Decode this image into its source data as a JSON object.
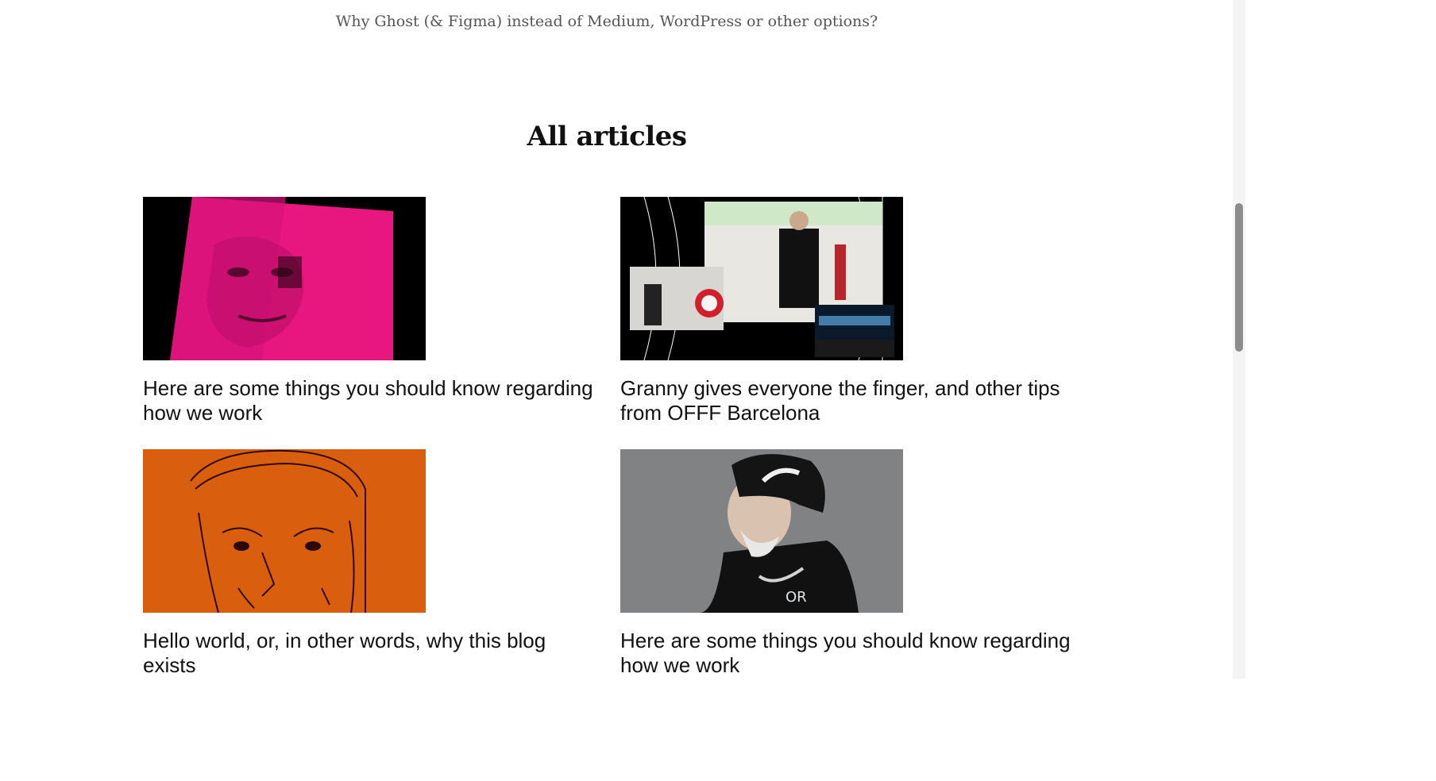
{
  "featured_link": "Why Ghost (& Figma) instead of Medium, WordPress or other options?",
  "section_title": "All articles",
  "articles": [
    {
      "title": "Here are some things you should know regarding how we work",
      "image": "pink-face-on-black-image"
    },
    {
      "title": "Granny gives everyone the finger, and other tips from OFFF Barcelona",
      "image": "event-photo-collage-image"
    },
    {
      "title": "Hello world, or, in other words, why this blog exists",
      "image": "orange-face-sketch-image"
    },
    {
      "title": "Here are some things you should know regarding how we work",
      "image": "street-art-old-man-image"
    }
  ],
  "colors": {
    "pink": "#e8177f",
    "orange": "#d95f0e",
    "black": "#000000",
    "concrete": "#8a8c8c"
  }
}
